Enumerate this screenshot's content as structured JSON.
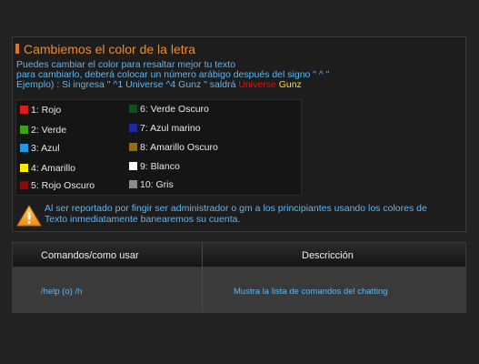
{
  "section": {
    "title": "Cambiemos el color de la letra",
    "intro_line1": "Puedes cambiar el color para resaltar mejor tu texto",
    "intro_line2": "para cambiarlo, deberá colocar un número  arábigo después del signo  \" ^ \"",
    "intro_line3_prefix": "Ejemplo) : Si ingresa \" ^1 Universe ^4 Gunz \" saldrá ",
    "intro_example_red": "Universe",
    "intro_example_yellow": "Gunz"
  },
  "colors": [
    {
      "label": "1: Rojo",
      "color": "#d81e1e"
    },
    {
      "label": "2: Verde",
      "color": "#3aa01e"
    },
    {
      "label": "3: Azul",
      "color": "#1e9ae6"
    },
    {
      "label": "4: Amarillo",
      "color": "#ffea00"
    },
    {
      "label": "5: Rojo Oscuro",
      "color": "#8a0a0a"
    },
    {
      "label": "6: Verde Oscuro",
      "color": "#12501a"
    },
    {
      "label": "7: Azul marino",
      "color": "#1e2aa0"
    },
    {
      "label": "8: Amarillo Oscuro",
      "color": "#9a6a10"
    },
    {
      "label": "9: Blanco",
      "color": "#ffffff"
    },
    {
      "label": "10: Gris",
      "color": "#8a8a8a"
    }
  ],
  "warning": {
    "icon": "warning-triangle-icon",
    "line1": "Al ser reportado por fingir ser administrador o gm a los principiantes usando los colores de",
    "line2": "Texto inmediatamente banearemos su cuenta."
  },
  "commands": {
    "col1_header": "Comandos/como usar",
    "col2_header": "Descricción",
    "rows": [
      {
        "command": "/help (o) /h",
        "description": "Mustra la lista de comandos del chatting"
      }
    ]
  }
}
